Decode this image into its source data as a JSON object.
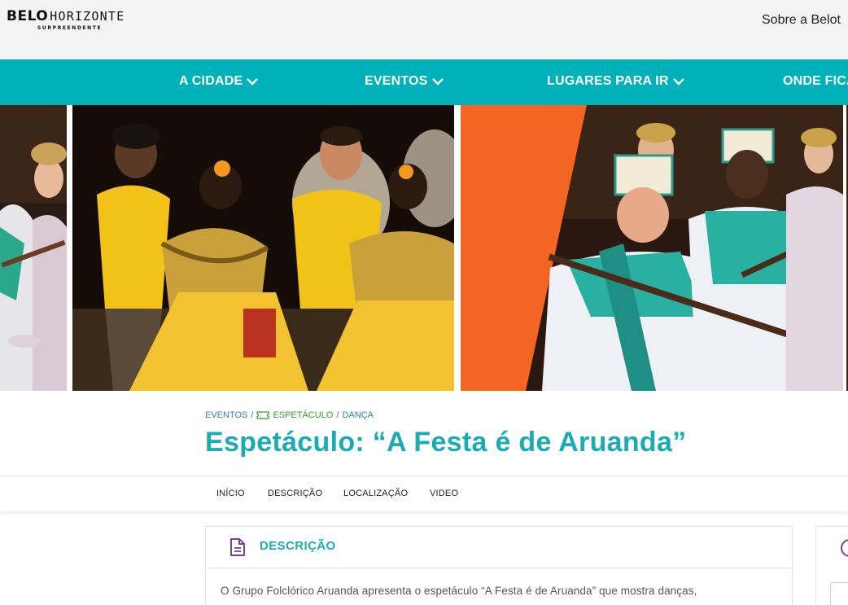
{
  "header": {
    "logo_main": "BELO",
    "logo_accent": "HORIZONTE",
    "logo_tagline": "SURPREENDENTE",
    "top_link": "Sobre a Belot"
  },
  "mainnav": {
    "items": [
      {
        "label": "A CIDADE"
      },
      {
        "label": "EVENTOS"
      },
      {
        "label": "LUGARES PARA IR"
      },
      {
        "label": "ONDE FICA"
      }
    ]
  },
  "hero": {
    "tiles": [
      {
        "name": "festival-photo-left"
      },
      {
        "name": "festival-photo-yellow-dancers"
      },
      {
        "name": "festival-photo-kings"
      },
      {
        "name": "festival-photo-right"
      }
    ],
    "accent_color": "#f26522"
  },
  "breadcrumb": {
    "items": [
      "EVENTOS",
      "ESPETÁCULO",
      "DANÇA"
    ],
    "separator": "/"
  },
  "page": {
    "title": "Espetáculo: “A Festa é de Aruanda”"
  },
  "subnav": {
    "items": [
      "INÍCIO",
      "DESCRIÇÃO",
      "LOCALIZAÇÃO",
      "VIDEO"
    ]
  },
  "description": {
    "heading": "DESCRIÇÃO",
    "text": "O Grupo Folclórico Aruanda apresenta o espetáculo “A Festa é de Aruanda” que mostra danças,"
  },
  "colors": {
    "brand_teal": "#00b1ba",
    "title_teal": "#1aabb5",
    "purple_icon": "#7b3fa0",
    "link_blue": "#2f7fc1",
    "link_green": "#3a9a2c"
  },
  "icons": {
    "chevron": "chevron-down-icon",
    "ticket": "ticket-icon",
    "document": "document-icon",
    "info": "info-icon"
  }
}
